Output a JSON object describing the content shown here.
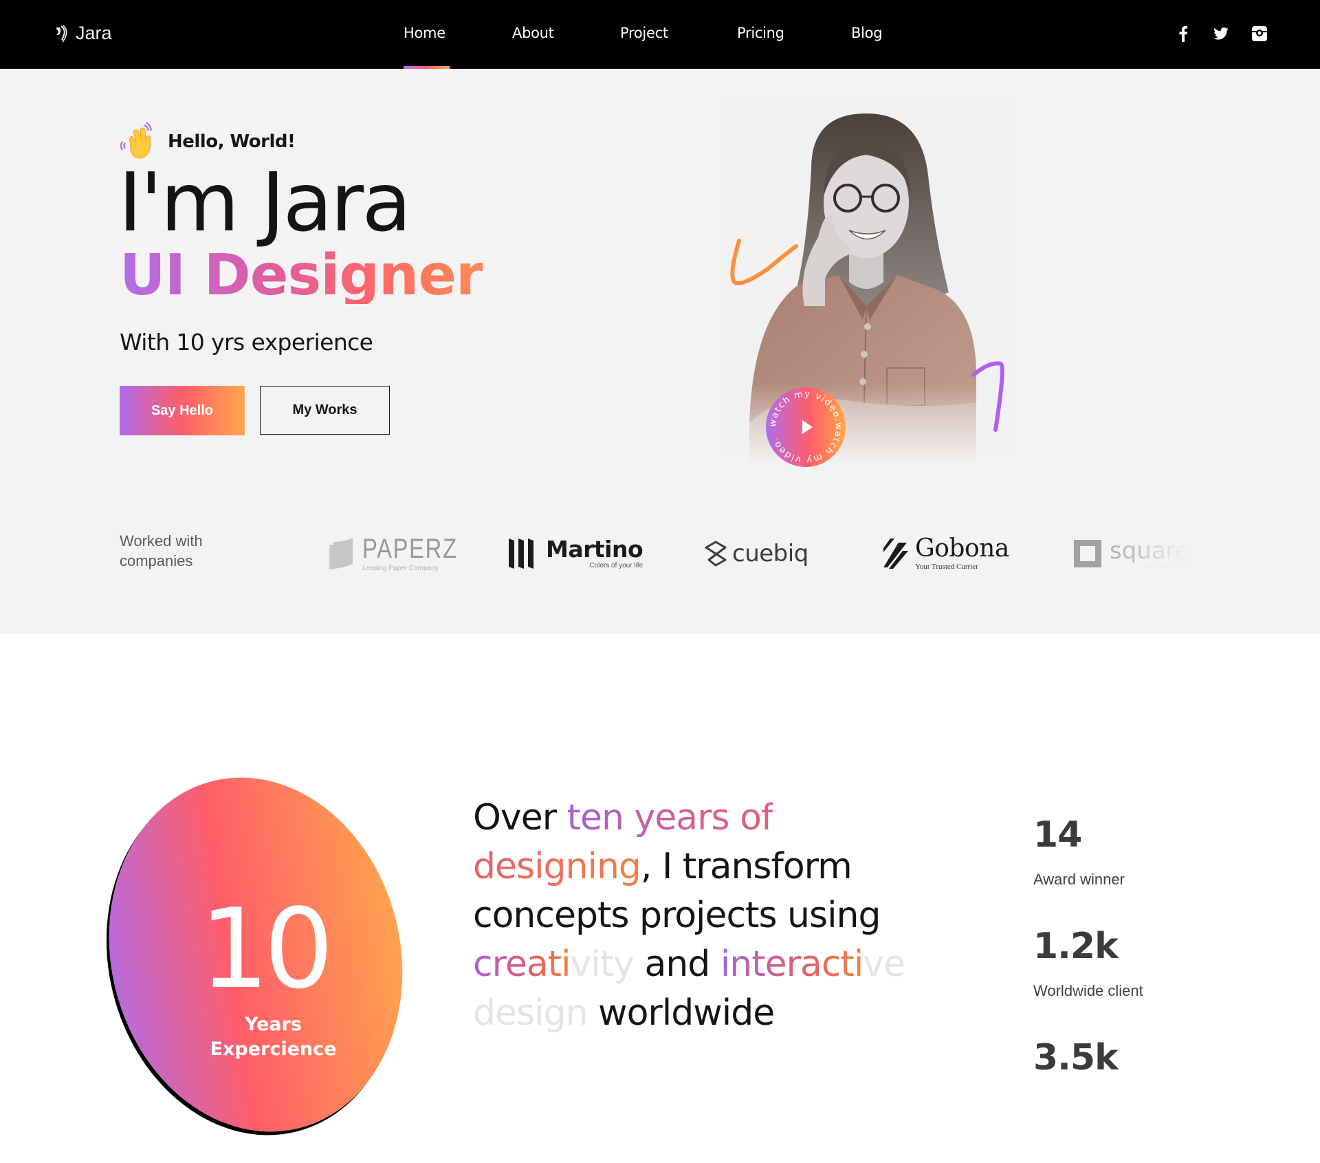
{
  "brand": {
    "name": "Jara"
  },
  "nav": {
    "items": [
      {
        "label": "Home",
        "active": true
      },
      {
        "label": "About"
      },
      {
        "label": "Project"
      },
      {
        "label": "Pricing"
      },
      {
        "label": "Blog"
      }
    ],
    "social": [
      "facebook-icon",
      "twitter-icon",
      "instagram-icon"
    ]
  },
  "colors": {
    "gradient_start": "#b16cea",
    "gradient_mid": "#ff5e69",
    "gradient_end": "#ffa84b",
    "nav_bg": "#000000",
    "hero_bg": "#f3f3f3"
  },
  "hero": {
    "greeting": "Hello, World!",
    "headline": "I'm Jara",
    "role": "UI Designer",
    "subhead": "With 10 yrs experience",
    "primary_button": "Say Hello",
    "secondary_button": "My Works",
    "video_badge_text": "watch my video.watch my video."
  },
  "companies": {
    "label": "Worked with companies",
    "logos": [
      {
        "name": "PAPERZ",
        "tagline": "Leading Paper Company"
      },
      {
        "name": "Martino",
        "tagline": "Colors of your life"
      },
      {
        "name": "cuebiq",
        "tagline": ""
      },
      {
        "name": "Gobona",
        "tagline": "Your Trusted Currier"
      },
      {
        "name": "square",
        "tagline": "Real Estate Solution"
      }
    ]
  },
  "about": {
    "experience_number": "10",
    "experience_label_1": "Years",
    "experience_label_2": "Expercience",
    "statement": {
      "p1": "Over ",
      "p2": "ten years of",
      "p3": "designing",
      "p4": ", I transform concepts projects using ",
      "p5": "creati",
      "p6": "vity",
      "p7": " and ",
      "p8": "interacti",
      "p9": "ve design",
      "p10": " worldwide"
    },
    "stats": [
      {
        "value": "14",
        "label": "Award winner"
      },
      {
        "value": "1.2k",
        "label": "Worldwide client"
      },
      {
        "value": "3.5k",
        "label": ""
      }
    ]
  }
}
